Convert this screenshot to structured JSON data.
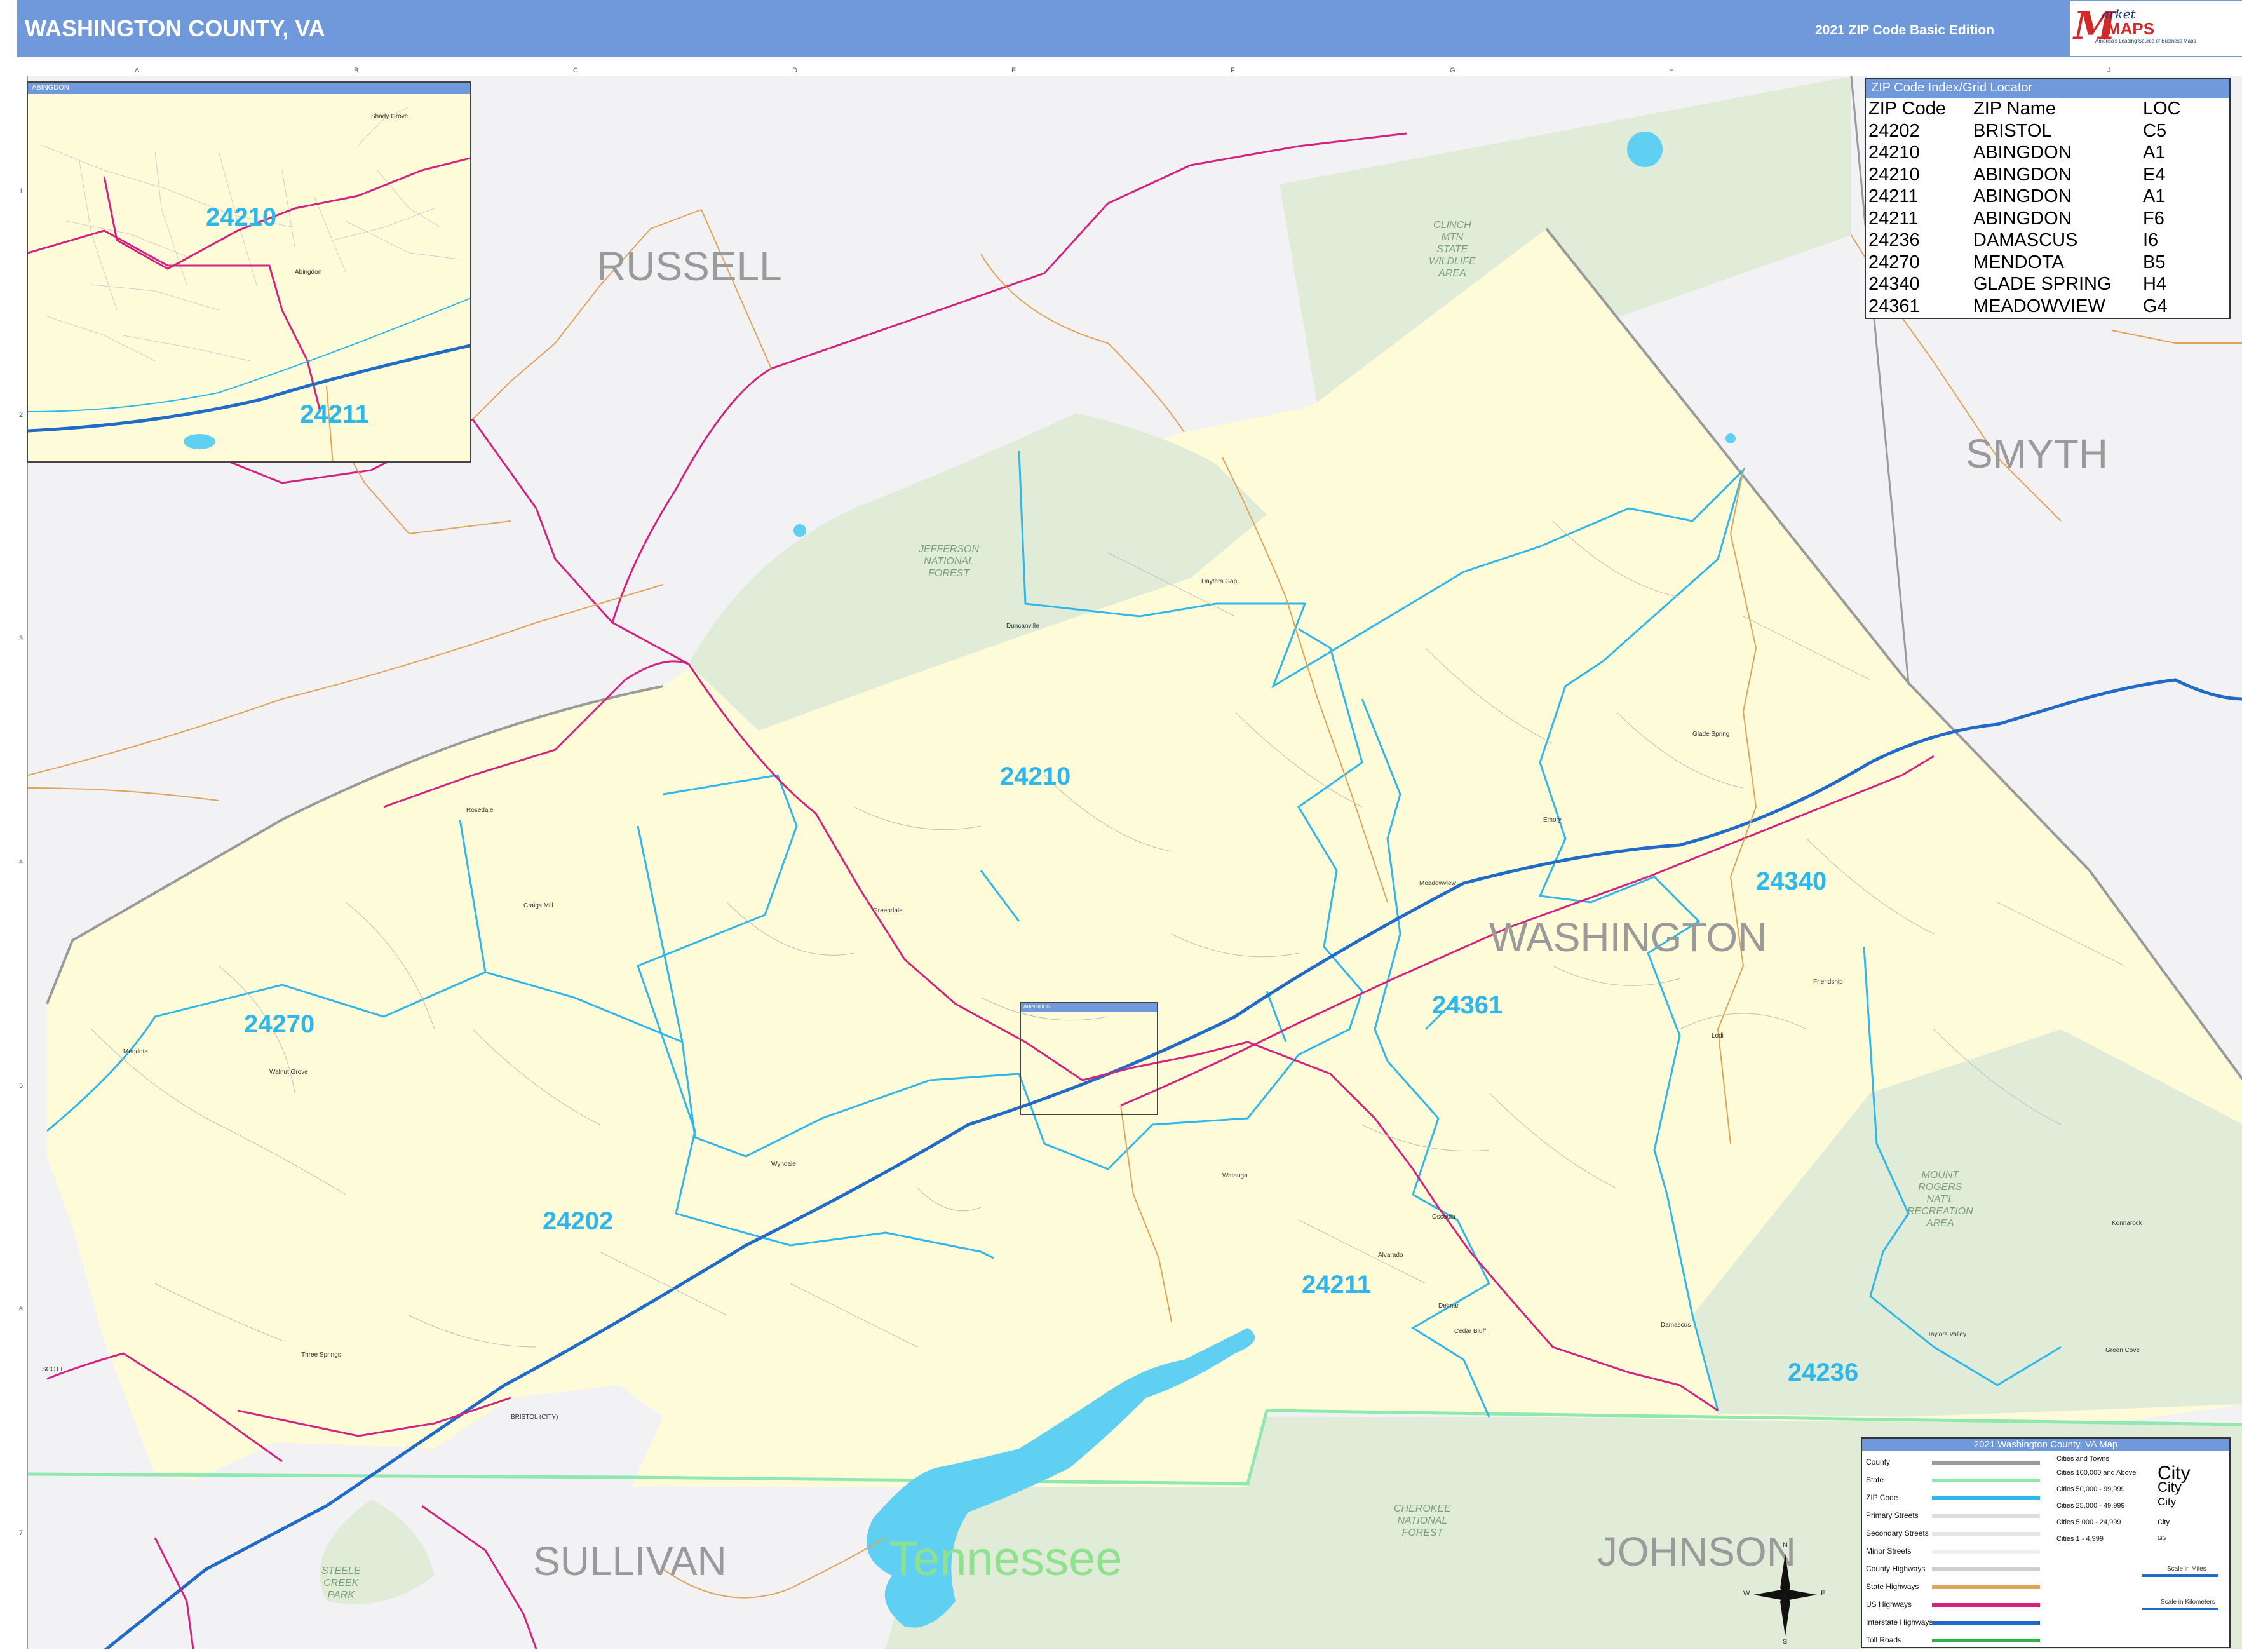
{
  "header": {
    "title": "WASHINGTON COUNTY, VA",
    "edition": "2021 ZIP Code Basic Edition",
    "logo": {
      "word1": "arket",
      "word2": "MAPS",
      "tagline": "On Target, On Time.",
      "slogan": "America's Leading Source of Business Maps"
    }
  },
  "grid": {
    "letters": [
      "A",
      "B",
      "C",
      "D",
      "E",
      "F",
      "G",
      "H",
      "I",
      "J"
    ],
    "numbers": [
      "1",
      "2",
      "3",
      "4",
      "5",
      "6",
      "7"
    ]
  },
  "counties": {
    "russell": "RUSSELL",
    "smyth": "SMYTH",
    "washington": "WASHINGTON",
    "sullivan": "SULLIVAN",
    "johnson": "JOHNSON",
    "scott": "SCOTT",
    "bristol_city": "BRISTOL (CITY)"
  },
  "state": "Tennessee",
  "zip_labels": {
    "z24210": "24210",
    "z24202": "24202",
    "z24270": "24270",
    "z24211": "24211",
    "z24361": "24361",
    "z24340": "24340",
    "z24236": "24236"
  },
  "green_areas": {
    "jefferson": "JEFFERSON\nNATIONAL\nFOREST",
    "clinch": "CLINCH\nMTN\nSTATE\nWILDLIFE\nAREA",
    "mount_rogers": "MOUNT\nROGERS\nNAT'L\nRECREATION\nAREA",
    "cherokee": "CHEROKEE\nNATIONAL\nFOREST",
    "steele_creek": "STEELE\nCREEK\nPARK"
  },
  "places": {
    "hayters_gap": "Hayters Gap",
    "duncanville": "Duncanville",
    "rosedale": "Rosedale",
    "craigs_mill": "Craigs Mill",
    "greendale": "Greendale",
    "wyndale": "Wyndale",
    "meadowview": "Meadowview",
    "emory": "Emory",
    "glade_spring": "Glade Spring",
    "damascus": "Damascus",
    "mendota": "Mendota",
    "lodi": "Lodi",
    "friendship": "Friendship",
    "konnarock": "Konnarock",
    "taylors_valley": "Taylors Valley",
    "watauga": "Watauga",
    "alvarado": "Alvarado",
    "delmar": "Delmar",
    "cedar_bluff": "Cedar Bluff",
    "three_springs": "Three Springs",
    "walnut_grove": "Walnut Grove",
    "osceola": "Osceola",
    "green_cove": "Green Cove"
  },
  "index": {
    "title": "ZIP Code Index/Grid Locator",
    "columns": [
      "ZIP Code",
      "ZIP Name",
      "LOC"
    ],
    "rows": [
      [
        "24202",
        "BRISTOL",
        "C5"
      ],
      [
        "24210",
        "ABINGDON",
        "A1"
      ],
      [
        "24210",
        "ABINGDON",
        "E4"
      ],
      [
        "24211",
        "ABINGDON",
        "A1"
      ],
      [
        "24211",
        "ABINGDON",
        "F6"
      ],
      [
        "24236",
        "DAMASCUS",
        "I6"
      ],
      [
        "24270",
        "MENDOTA",
        "B5"
      ],
      [
        "24340",
        "GLADE SPRING",
        "H4"
      ],
      [
        "24361",
        "MEADOWVIEW",
        "G4"
      ]
    ]
  },
  "inset": {
    "title": "ABINGDON",
    "zip_top": "24210",
    "zip_bottom": "24211",
    "place_abingdon": "Abingdon",
    "place_shady_grove": "Shady Grove"
  },
  "inset_small_title": "ABINGDON",
  "legend": {
    "title": "2021 Washington County, VA Map",
    "items": [
      "County",
      "State",
      "ZIP Code",
      "Primary Streets",
      "Secondary Streets",
      "Minor Streets",
      "County Highways",
      "State Highways",
      "US Highways",
      "Interstate Highways",
      "Toll Roads"
    ],
    "cities_header": "Cities and Towns",
    "cities": [
      "Cities 100,000 and Above",
      "Cities 50,000 - 99,999",
      "Cities 25,000 - 49,999",
      "Cities 5,000 - 24,999",
      "Cities 1 - 4,999"
    ],
    "city_word": "City",
    "scale_miles": "Scale in Miles",
    "scale_km": "Scale in Kilometers"
  },
  "compass": {
    "n": "N",
    "s": "S",
    "e": "E",
    "w": "W"
  },
  "colors": {
    "header": "#6f99db",
    "county_fill": "#fefbd9",
    "outside": "#f2f2f4",
    "green": "#e0ebd8",
    "water": "#5fd0f2",
    "zip_line": "#2fb6ea",
    "us_highway": "#d4227f",
    "interstate": "#1f6bc7",
    "state_line": "#8fe8b0",
    "secondary": "#e0a35a"
  }
}
